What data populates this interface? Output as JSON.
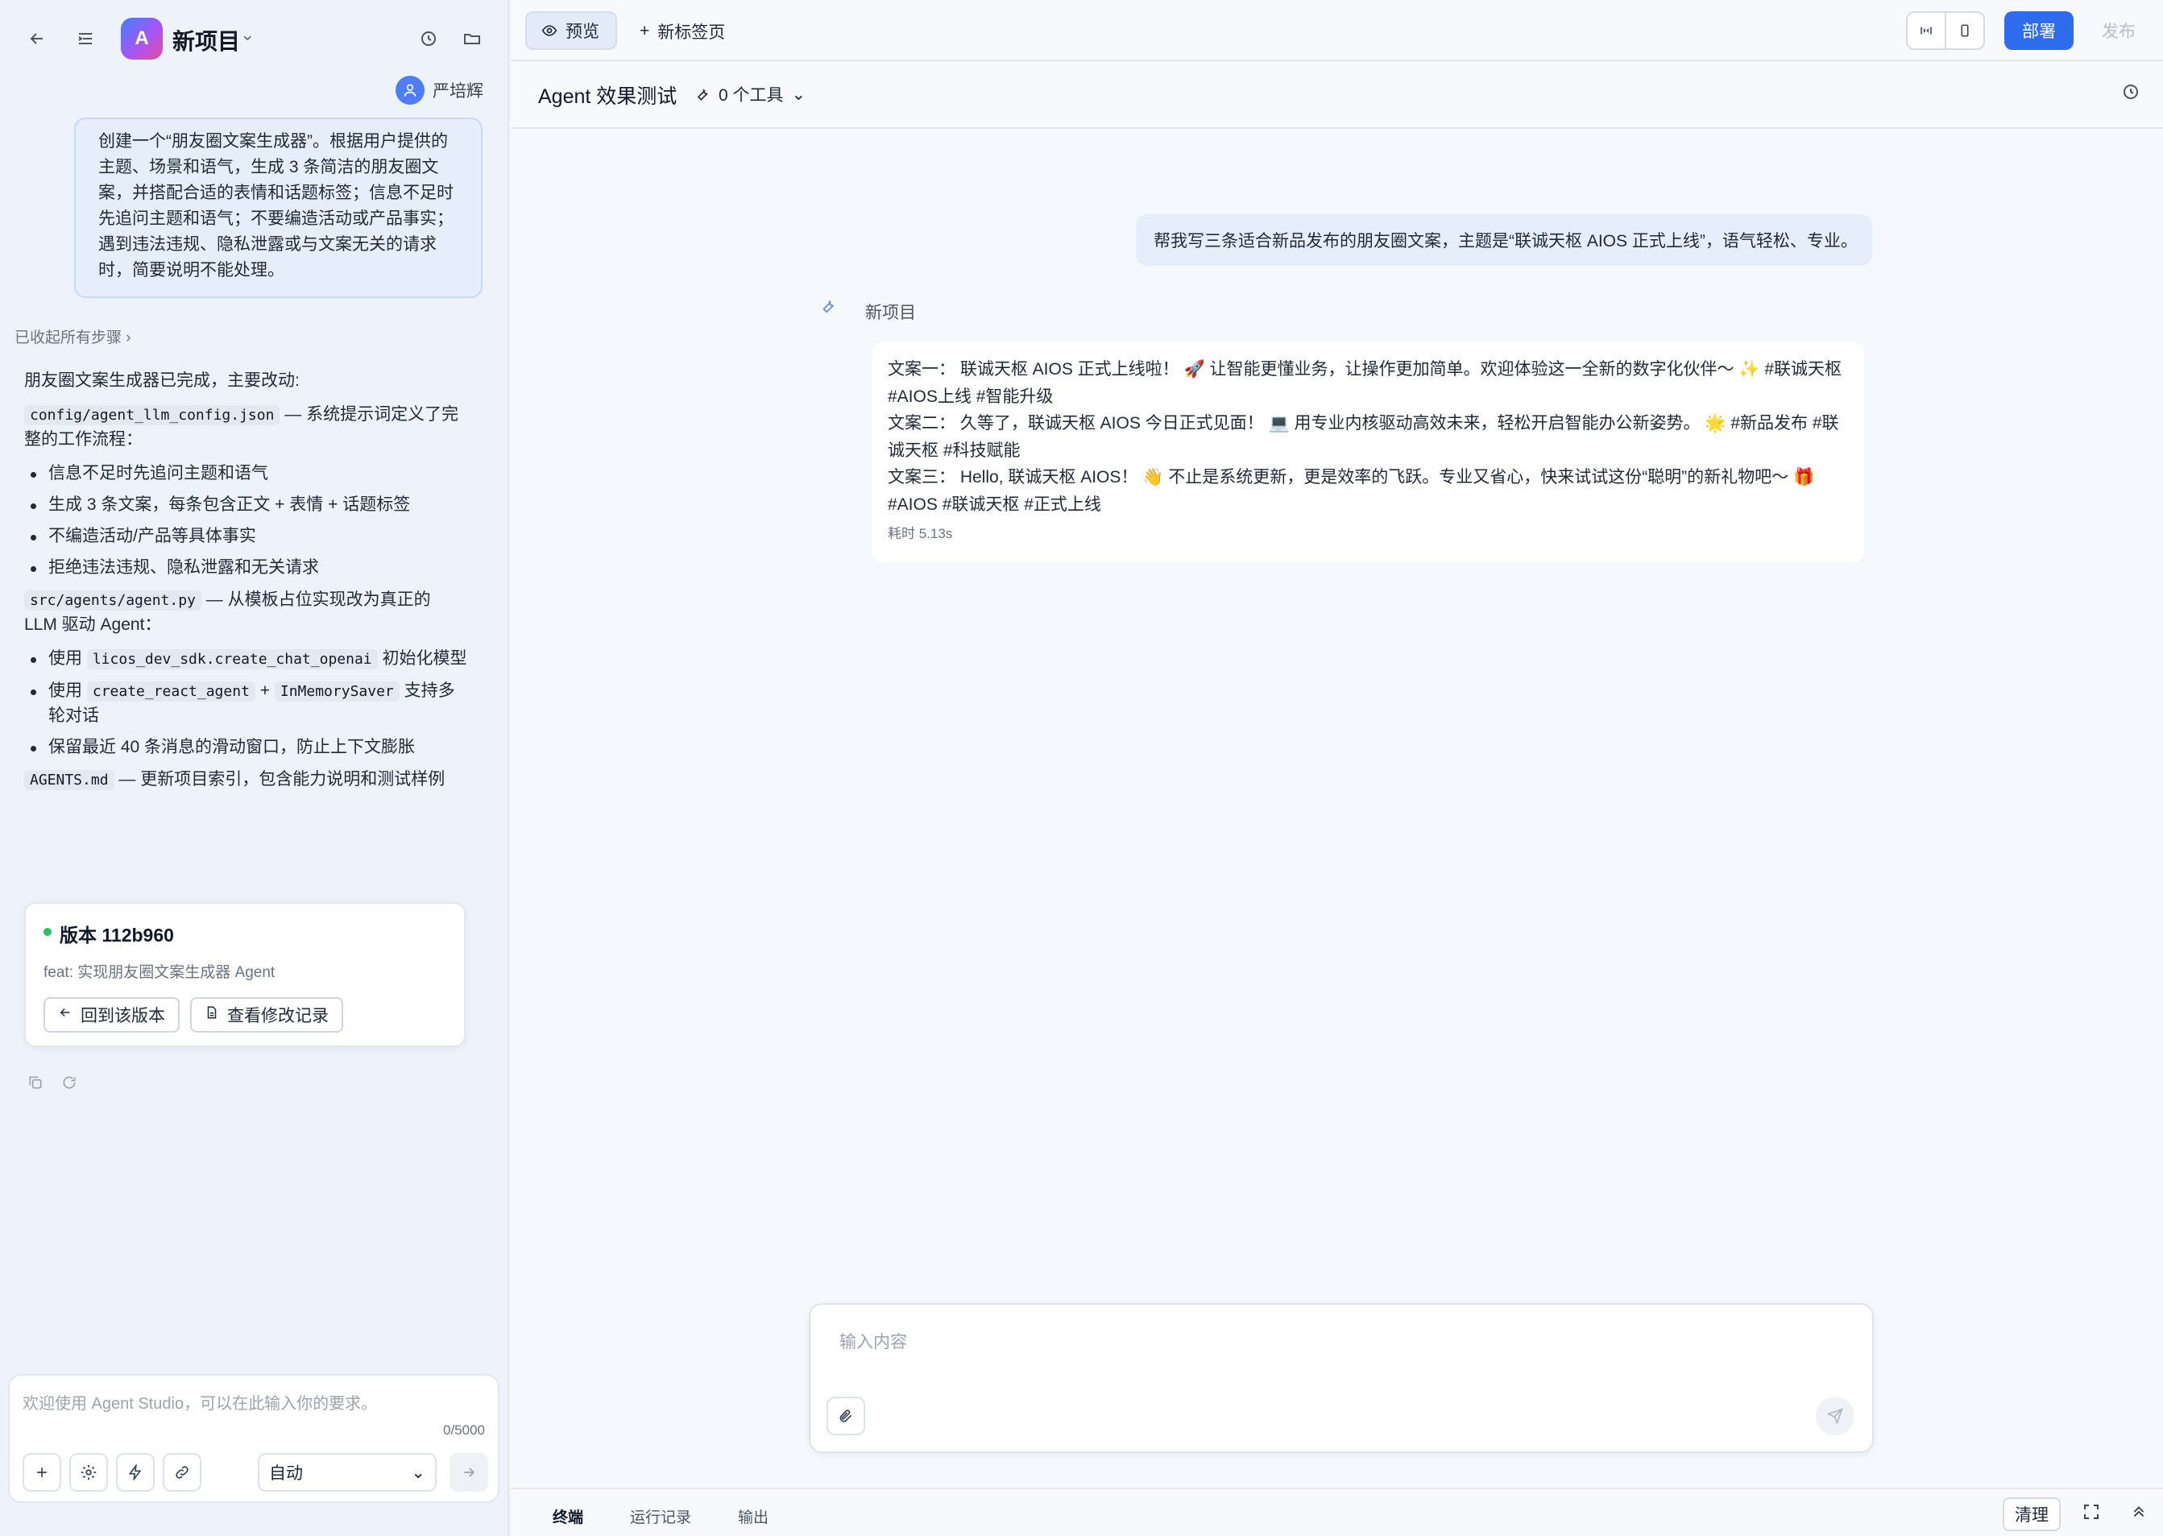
{
  "left": {
    "project_avatar_letter": "A",
    "project_name": "新项目",
    "user_name": "严培辉",
    "user_prompt": "创建一个“朋友圈文案生成器”。根据用户提供的主题、场景和语气，生成 3 条简洁的朋友圈文案，并搭配合适的表情和话题标签；信息不足时先追问主题和语气；不要编造活动或产品事实；遇到违法违规、隐私泄露或与文案无关的请求时，简要说明不能处理。",
    "collapse_label": "已收起所有步骤",
    "summary_intro": "朋友圈文案生成器已完成，主要改动:",
    "file1": "config/agent_llm_config.json",
    "file1_desc": "— 系统提示词定义了完整的工作流程：",
    "file1_items": [
      "信息不足时先追问主题和语气",
      "生成 3 条文案，每条包含正文 + 表情 + 话题标签",
      "不编造活动/产品等具体事实",
      "拒绝违法违规、隐私泄露和无关请求"
    ],
    "file2": "src/agents/agent.py",
    "file2_desc": "— 从模板占位实现改为真正的 LLM 驱动 Agent：",
    "file2_item1_pre": "使用",
    "file2_item1_code": "licos_dev_sdk.create_chat_openai",
    "file2_item1_post": "初始化模型",
    "file2_item2_pre": "使用",
    "file2_item2_code1": "create_react_agent",
    "file2_item2_plus": "+",
    "file2_item2_code2": "InMemorySaver",
    "file2_item2_post": "支持多轮对话",
    "file2_item3": "保留最近 40 条消息的滑动窗口，防止上下文膨胀",
    "file3": "AGENTS.md",
    "file3_desc": "— 更新项目索引，包含能力说明和测试样例",
    "version": {
      "title": "版本 112b960",
      "desc": "feat: 实现朋友圈文案生成器 Agent",
      "revert_label": "回到该版本",
      "changes_label": "查看修改记录"
    },
    "input_placeholder": "欢迎使用 Agent Studio，可以在此输入你的要求。",
    "counter": "0/5000",
    "mode": "自动"
  },
  "right": {
    "tab_preview": "预览",
    "tab_new": "新标签页",
    "deploy": "部署",
    "publish": "发布",
    "sub_title": "Agent 效果测试",
    "tools": "0 个工具",
    "user_message": "帮我写三条适合新品发布的朋友圈文案，主题是“联诚天枢 AIOS 正式上线”，语气轻松、专业。",
    "agent_name": "新项目",
    "agent_lines": [
      "文案一： 联诚天枢 AIOS 正式上线啦！ 🚀 让智能更懂业务，让操作更加简单。欢迎体验这一全新的数字化伙伴～ ✨ #联诚天枢",
      "#AIOS上线 #智能升级",
      "文案二： 久等了，联诚天枢 AIOS 今日正式见面！ 💻 用专业内核驱动高效未来，轻松开启智能办公新姿势。 🌟 #新品发布 #联",
      "诚天枢 #科技赋能",
      "文案三： Hello, 联诚天枢 AIOS！ 👋 不止是系统更新，更是效率的飞跃。专业又省心，快来试试这份“聪明”的新礼物吧～ 🎁",
      "#AIOS #联诚天枢 #正式上线"
    ],
    "elapsed": "耗时 5.13s",
    "chat_placeholder": "输入内容",
    "bottom_tabs": [
      "终端",
      "运行记录",
      "输出"
    ],
    "clear": "清理"
  }
}
